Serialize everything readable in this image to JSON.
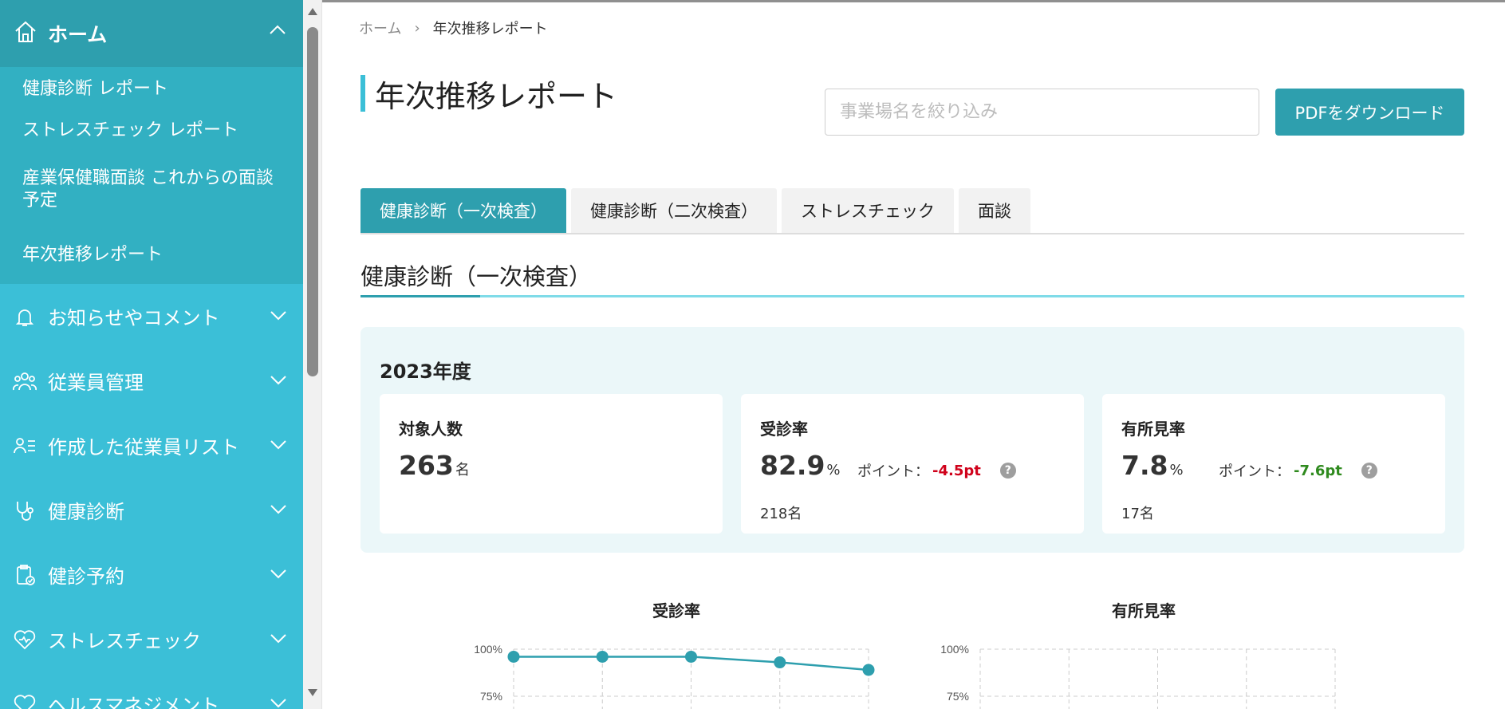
{
  "sidebar": {
    "home_label": "ホーム",
    "subitems": [
      "健康診断 レポート",
      "ストレスチェック レポート",
      "産業保健職面談 これからの面談予定",
      "年次推移レポート"
    ],
    "items": [
      {
        "label": "お知らせやコメント",
        "icon": "bell-icon"
      },
      {
        "label": "従業員管理",
        "icon": "users-icon"
      },
      {
        "label": "作成した従業員リスト",
        "icon": "user-list-icon"
      },
      {
        "label": "健康診断",
        "icon": "stethoscope-icon"
      },
      {
        "label": "健診予約",
        "icon": "clipboard-check-icon"
      },
      {
        "label": "ストレスチェック",
        "icon": "heart-icon"
      },
      {
        "label": "ヘルスマネジメント",
        "icon": "heart-icon"
      }
    ]
  },
  "breadcrumb": {
    "home": "ホーム",
    "separator": "›",
    "current": "年次推移レポート"
  },
  "page_title": "年次推移レポート",
  "search": {
    "placeholder": "事業場名を絞り込み",
    "value": ""
  },
  "pdf_button": "PDFをダウンロード",
  "tabs": [
    "健康診断（一次検査）",
    "健康診断（二次検査）",
    "ストレスチェック",
    "面談"
  ],
  "active_tab": 0,
  "section_title": "健康診断（一次検査）",
  "summary": {
    "year": "2023年度",
    "cards": [
      {
        "title": "対象人数",
        "value": "263",
        "unit": "名"
      },
      {
        "title": "受診率",
        "value": "82.9",
        "unit": "%",
        "point_label": "ポイント：",
        "point_value": "-4.5pt",
        "sub": "218名"
      },
      {
        "title": "有所見率",
        "value": "7.8",
        "unit": "%",
        "point_label": "ポイント：",
        "point_value": "-7.6pt",
        "sub": "17名"
      }
    ]
  },
  "colors": {
    "accent": "#2e9fae",
    "sidebar": "#3bbfd7",
    "negative": "#d0021b",
    "positive": "#2f8a1e"
  },
  "chart_data": [
    {
      "type": "line",
      "title": "受診率",
      "ytick_labels": [
        "100%",
        "75%"
      ],
      "ylim": [
        0,
        100
      ],
      "values": [
        96,
        96,
        96,
        93,
        89
      ],
      "grid": true
    },
    {
      "type": "line",
      "title": "有所見率",
      "ytick_labels": [
        "100%",
        "75%"
      ],
      "ylim": [
        0,
        100
      ],
      "values": [],
      "grid": true
    }
  ]
}
